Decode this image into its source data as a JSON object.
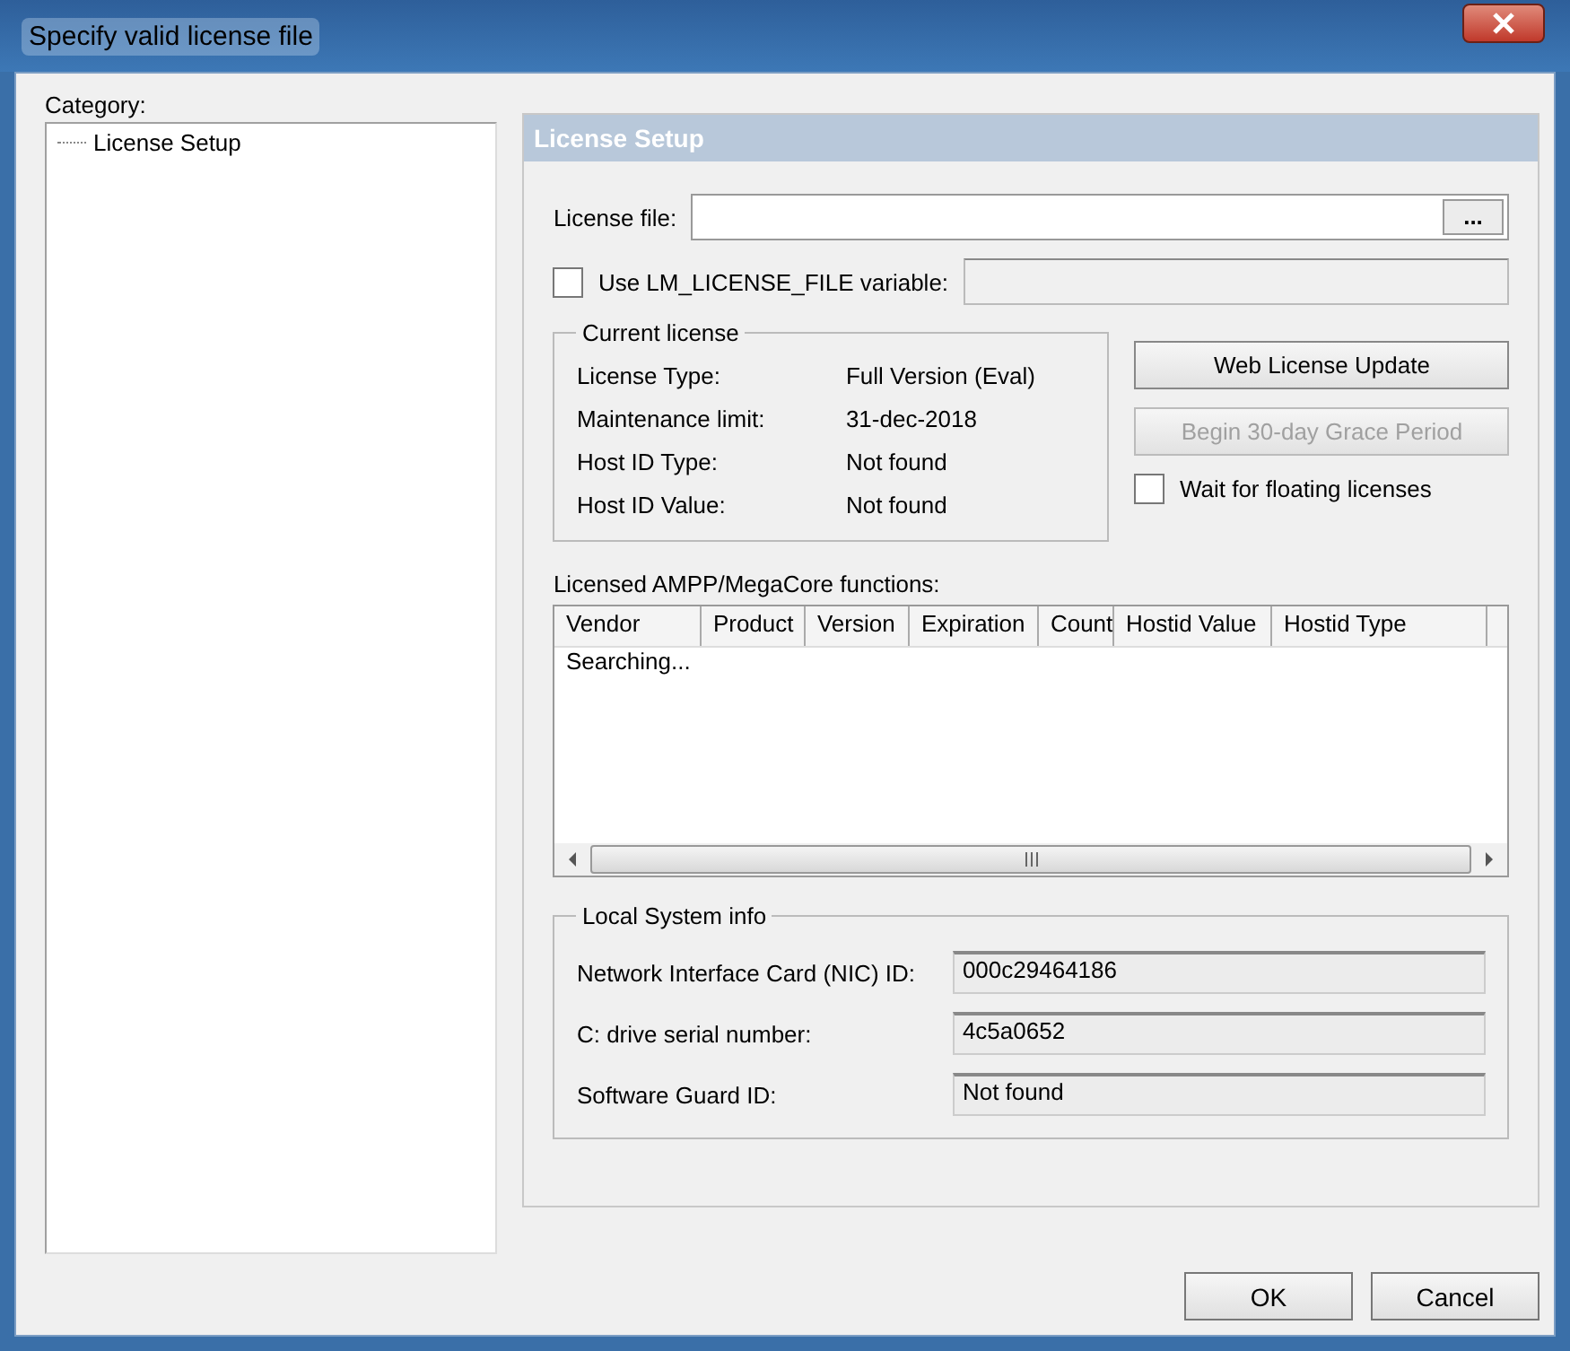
{
  "window": {
    "title": "Specify valid license file"
  },
  "category": {
    "label": "Category:",
    "items": [
      {
        "label": "License Setup",
        "selected": false
      }
    ]
  },
  "panel": {
    "title": "License Setup",
    "license_file": {
      "label": "License file:",
      "browse": "..."
    },
    "use_lm": {
      "label": "Use LM_LICENSE_FILE variable:",
      "checked": false
    },
    "current_license": {
      "title": "Current license",
      "rows": [
        {
          "label": "License Type:",
          "value": "Full Version (Eval)"
        },
        {
          "label": "Maintenance limit:",
          "value": "31-dec-2018"
        },
        {
          "label": "Host ID Type:",
          "value": "Not found"
        },
        {
          "label": "Host ID Value:",
          "value": "Not found"
        }
      ]
    },
    "buttons": [
      {
        "label": "Web License Update",
        "disabled": false
      },
      {
        "label": "Begin 30-day Grace Period",
        "disabled": true
      }
    ],
    "wait_floating": {
      "label": "Wait for floating licenses",
      "checked": false
    },
    "functions": {
      "label": "Licensed AMPP/MegaCore functions:",
      "columns": [
        "Vendor",
        "Product",
        "Version",
        "Expiration",
        "Count",
        "Hostid Value",
        "Hostid Type"
      ],
      "status": "Searching..."
    },
    "local_system": {
      "title": "Local System info",
      "rows": [
        {
          "label": "Network Interface Card (NIC) ID:",
          "value": "000c29464186"
        },
        {
          "label": "C: drive serial number:",
          "value": "4c5a0652"
        },
        {
          "label": "Software Guard ID:",
          "value": "Not found"
        }
      ]
    }
  },
  "footer": {
    "buttons": [
      "OK",
      "Cancel"
    ]
  }
}
